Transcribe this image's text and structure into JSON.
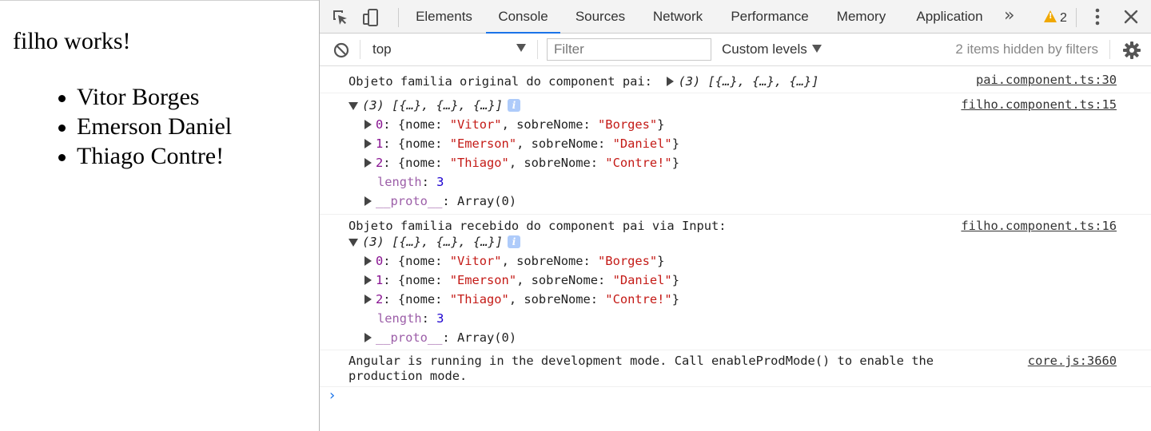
{
  "page": {
    "title": "filho works!",
    "items": [
      "Vitor Borges",
      "Emerson Daniel",
      "Thiago Contre!"
    ]
  },
  "devtools": {
    "tabs": [
      {
        "label": "Elements",
        "active": false
      },
      {
        "label": "Console",
        "active": true
      },
      {
        "label": "Sources",
        "active": false
      },
      {
        "label": "Network",
        "active": false
      },
      {
        "label": "Performance",
        "active": false
      },
      {
        "label": "Memory",
        "active": false
      },
      {
        "label": "Application",
        "active": false
      }
    ],
    "more_label": "»",
    "warning_count": "2"
  },
  "console_toolbar": {
    "context": "top",
    "filter_placeholder": "Filter",
    "levels": "Custom levels",
    "hidden_msg": "2 items hidden by filters"
  },
  "console": {
    "msg1": {
      "text": "Objeto familia original do component pai:",
      "summary": "(3) [{…}, {…}, {…}]",
      "source": "pai.component.ts:30"
    },
    "msg2": {
      "summary": "(3) [{…}, {…}, {…}]",
      "source": "filho.component.ts:15"
    },
    "msg3": {
      "text": "Objeto familia recebido do component pai via Input:",
      "summary": "(3) [{…}, {…}, {…}]",
      "source": "filho.component.ts:16"
    },
    "entries": [
      {
        "index": "0",
        "nome": "\"Vitor\"",
        "sobreNome": "\"Borges\""
      },
      {
        "index": "1",
        "nome": "\"Emerson\"",
        "sobreNome": "\"Daniel\""
      },
      {
        "index": "2",
        "nome": "\"Thiago\"",
        "sobreNome": "\"Contre!\""
      }
    ],
    "length_key": "length",
    "length_value": "3",
    "proto_key": "__proto__",
    "proto_value": "Array(0)",
    "msg4": {
      "line1": "Angular is running in the development mode. Call enableProdMode() to enable the",
      "line2": "production mode.",
      "source": "core.js:3660"
    }
  },
  "colors": {
    "accent": "#1a73e8",
    "string": "#c41a16",
    "key": "#881391",
    "number": "#1c00cf",
    "warning": "#f0a800"
  }
}
